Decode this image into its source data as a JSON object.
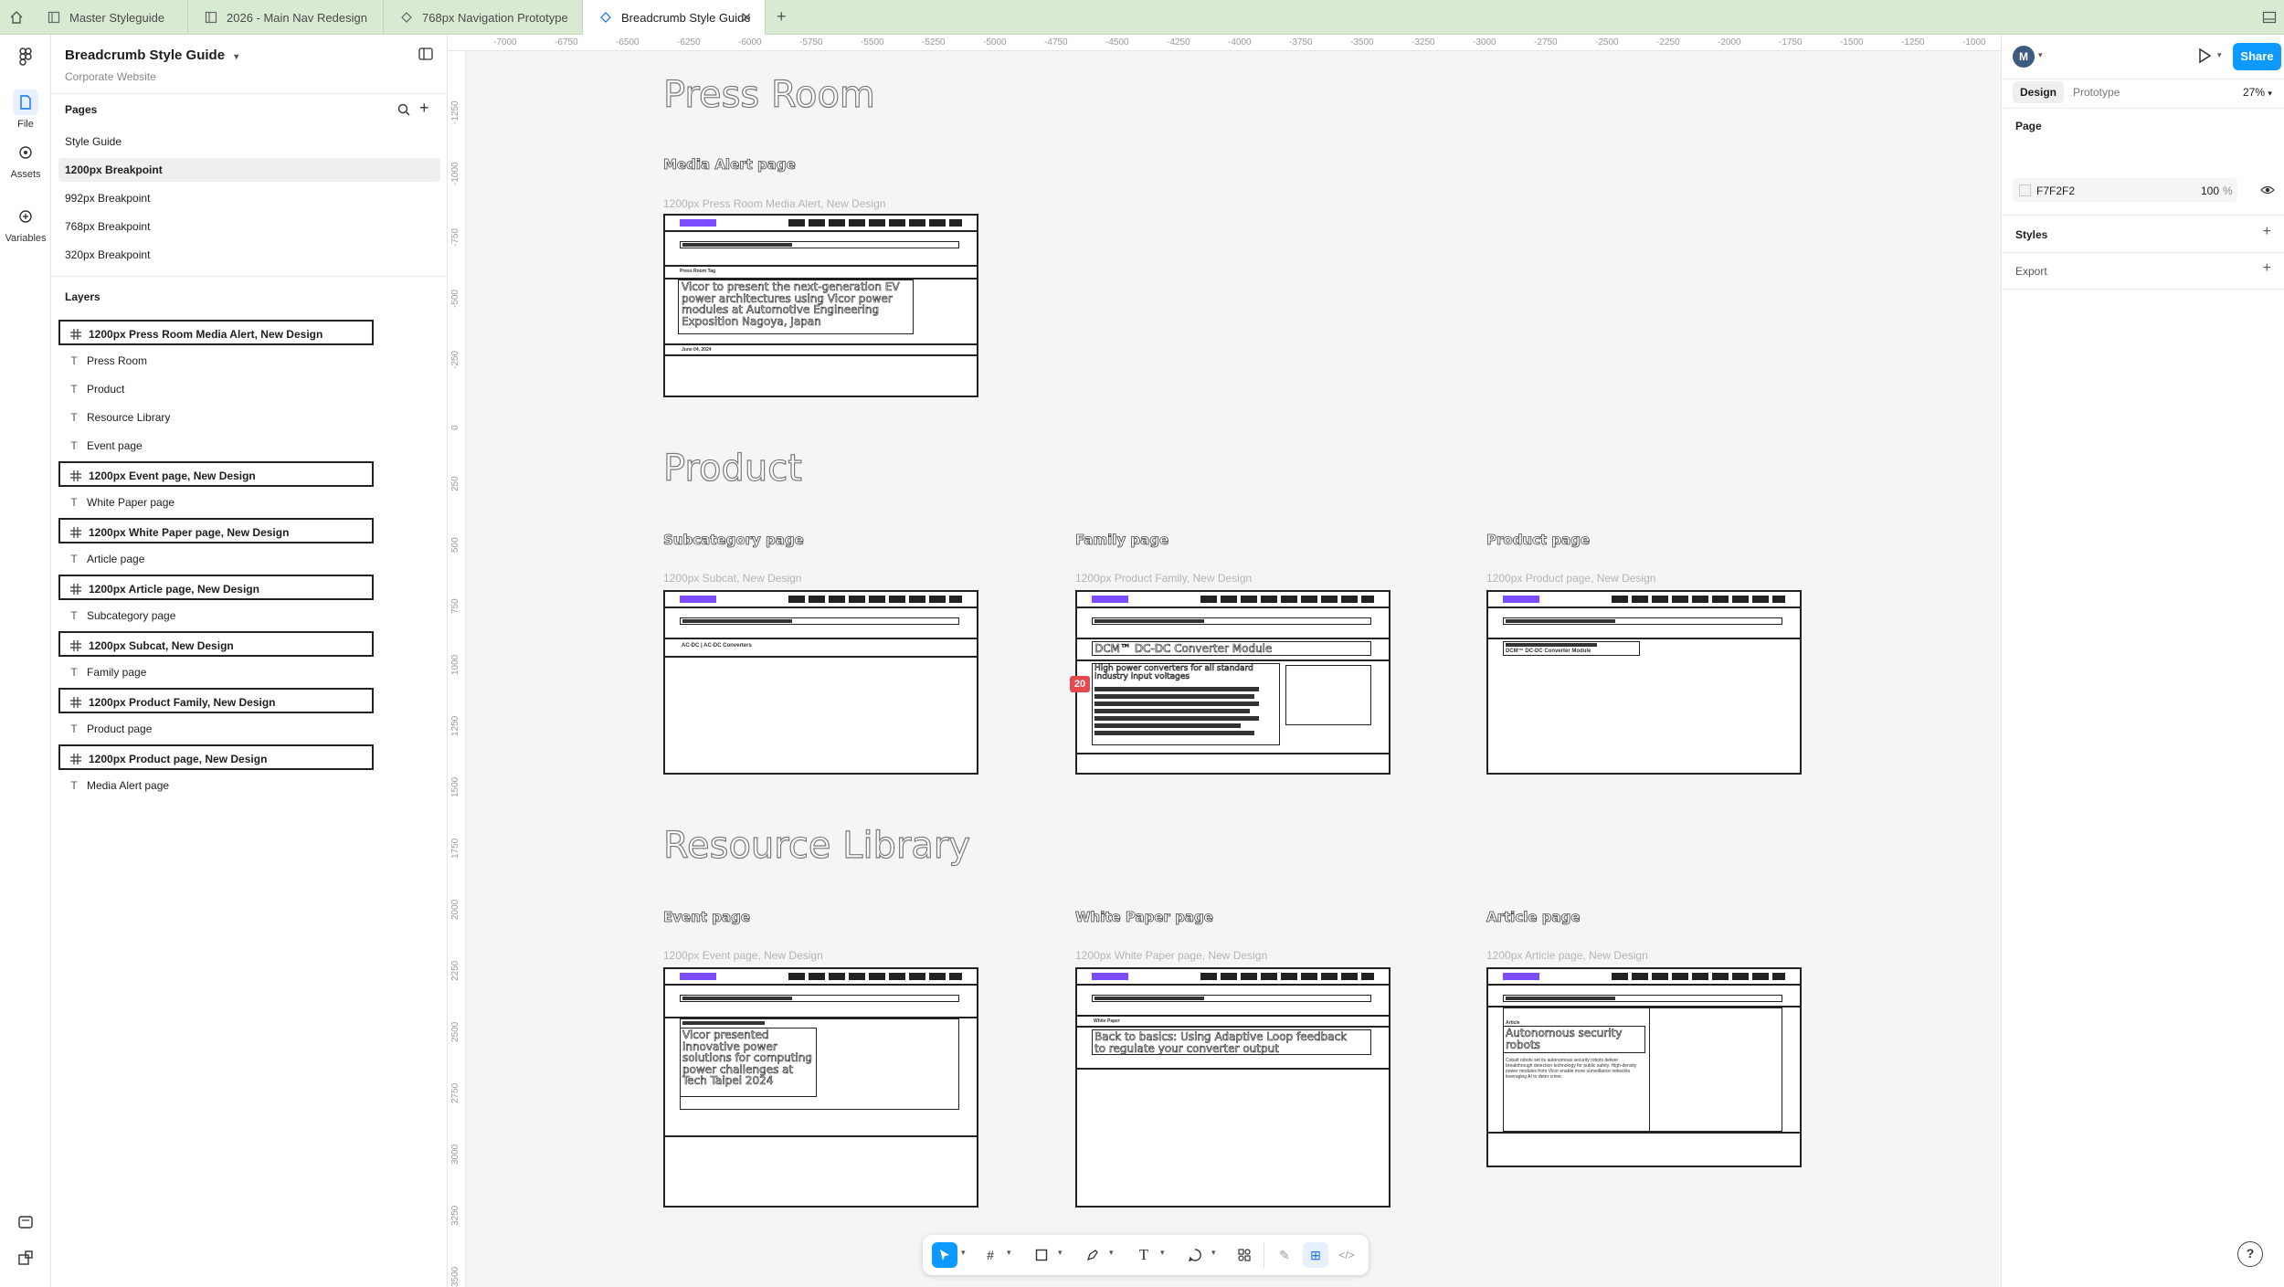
{
  "tabs": [
    {
      "label": "Master Styleguide",
      "icon": "file-icon"
    },
    {
      "label": "2026 - Main Nav Redesign",
      "icon": "file-icon"
    },
    {
      "label": "768px Navigation Prototype",
      "icon": "prototype-icon"
    },
    {
      "label": "Breadcrumb Style Guide",
      "icon": "prototype-icon",
      "active": true
    }
  ],
  "rail": {
    "file": "File",
    "assets": "Assets",
    "variables": "Variables"
  },
  "file": {
    "title": "Breadcrumb Style Guide",
    "project": "Corporate Website"
  },
  "pages": {
    "heading": "Pages",
    "items": [
      "Style Guide",
      "1200px Breakpoint",
      "992px Breakpoint",
      "768px Breakpoint",
      "320px Breakpoint"
    ],
    "selected": "1200px Breakpoint"
  },
  "layers": {
    "heading": "Layers",
    "items": [
      {
        "label": "1200px Press Room Media Alert, New Design",
        "type": "frame"
      },
      {
        "label": "Press Room",
        "type": "text"
      },
      {
        "label": "Product",
        "type": "text"
      },
      {
        "label": "Resource Library",
        "type": "text"
      },
      {
        "label": "Event page",
        "type": "text"
      },
      {
        "label": "1200px Event page, New Design",
        "type": "frame"
      },
      {
        "label": "White Paper page",
        "type": "text"
      },
      {
        "label": "1200px White Paper page, New Design",
        "type": "frame"
      },
      {
        "label": "Article page",
        "type": "text"
      },
      {
        "label": "1200px Article page, New Design",
        "type": "frame"
      },
      {
        "label": "Subcategory page",
        "type": "text"
      },
      {
        "label": "1200px Subcat, New Design",
        "type": "frame"
      },
      {
        "label": "Family page",
        "type": "text"
      },
      {
        "label": "1200px Product Family, New Design",
        "type": "frame"
      },
      {
        "label": "Product page",
        "type": "text"
      },
      {
        "label": "1200px Product page, New Design",
        "type": "frame"
      },
      {
        "label": "Media Alert page",
        "type": "text"
      }
    ]
  },
  "ruler": {
    "x_ticks": [
      "-7000",
      "-6750",
      "-6500",
      "-6250",
      "-6000",
      "-5750",
      "-5500",
      "-5250",
      "-5000",
      "-4750",
      "-4500",
      "-4250",
      "-4000",
      "-3750",
      "-3500",
      "-3250",
      "-3000",
      "-2750",
      "-2500",
      "-2250",
      "-2000",
      "-1750",
      "-1500",
      "-1250",
      "-1000"
    ],
    "y_ticks": [
      "-1250",
      "-1000",
      "-750",
      "-500",
      "-250",
      "0",
      "250",
      "500",
      "750",
      "1000",
      "1250",
      "1500",
      "1750",
      "2000",
      "2250",
      "2500",
      "2750",
      "3000",
      "3250",
      "3500"
    ]
  },
  "canvas": {
    "sections": {
      "press_room": "Press Room",
      "product": "Product",
      "resource_library": "Resource Library"
    },
    "page_names": {
      "media_alert": "Media Alert page",
      "subcategory": "Subcategory page",
      "family": "Family page",
      "product": "Product page",
      "event": "Event page",
      "white_paper": "White Paper page",
      "article": "Article page"
    },
    "frame_labels": {
      "media_alert": "1200px Press Room Media Alert, New Design",
      "subcategory": "1200px Subcat, New Design",
      "family": "1200px Product Family, New Design",
      "product": "1200px Product page, New Design",
      "event": "1200px Event page, New Design",
      "white_paper": "1200px White Paper page, New Design",
      "article": "1200px Article page, New Design"
    },
    "frame_content": {
      "media_alert_heading": "Vicor to present the next-generation EV power architectures using Vicor power modules at Automotive Engineering Exposition Nagoya, Japan",
      "media_alert_tag": "Press Room Tag",
      "media_alert_date": "June 04, 2024",
      "subcat_heading": "AC-DC | AC-DC Converters",
      "family_heading": "DCM™ DC-DC Converter Module",
      "family_sub": "High power converters for all standard industry input voltages",
      "family_badge": "20",
      "product_heading": "DCM™ DC-DC Converter Module",
      "event_heading": "Vicor presented innovative power solutions for computing power challenges at Tech Taipei 2024",
      "white_paper_tag": "White Paper",
      "white_paper_heading": "Back to basics: Using Adaptive Loop feedback to regulate your converter output",
      "article_tag": "Article",
      "article_heading": "Autonomous security robots",
      "article_body": "Cobalt robots set its autonomous security robots deliver breakthrough detection technology for public safety. High-density power modules from Vicor enable more surveillance networks leveraging AI to deter crime."
    }
  },
  "toolbar": {
    "tools": [
      "move-tool",
      "frame-tool",
      "shape-tool",
      "pen-tool",
      "text-tool",
      "comment-tool",
      "actions-tool",
      "draw-mode",
      "design-mode",
      "dev-mode"
    ]
  },
  "right": {
    "avatar": "M",
    "share": "Share",
    "tab_design": "Design",
    "tab_prototype": "Prototype",
    "zoom": "27%",
    "page_heading": "Page",
    "page_color": "F7F2F2",
    "page_opacity": "100",
    "page_pct": "%",
    "styles": "Styles",
    "export": "Export"
  },
  "help": "?",
  "colors": {
    "accent": "#0d99ff",
    "tabbar": "#d9ead3",
    "badge": "#e5484d",
    "logo": "#7c4dff"
  }
}
